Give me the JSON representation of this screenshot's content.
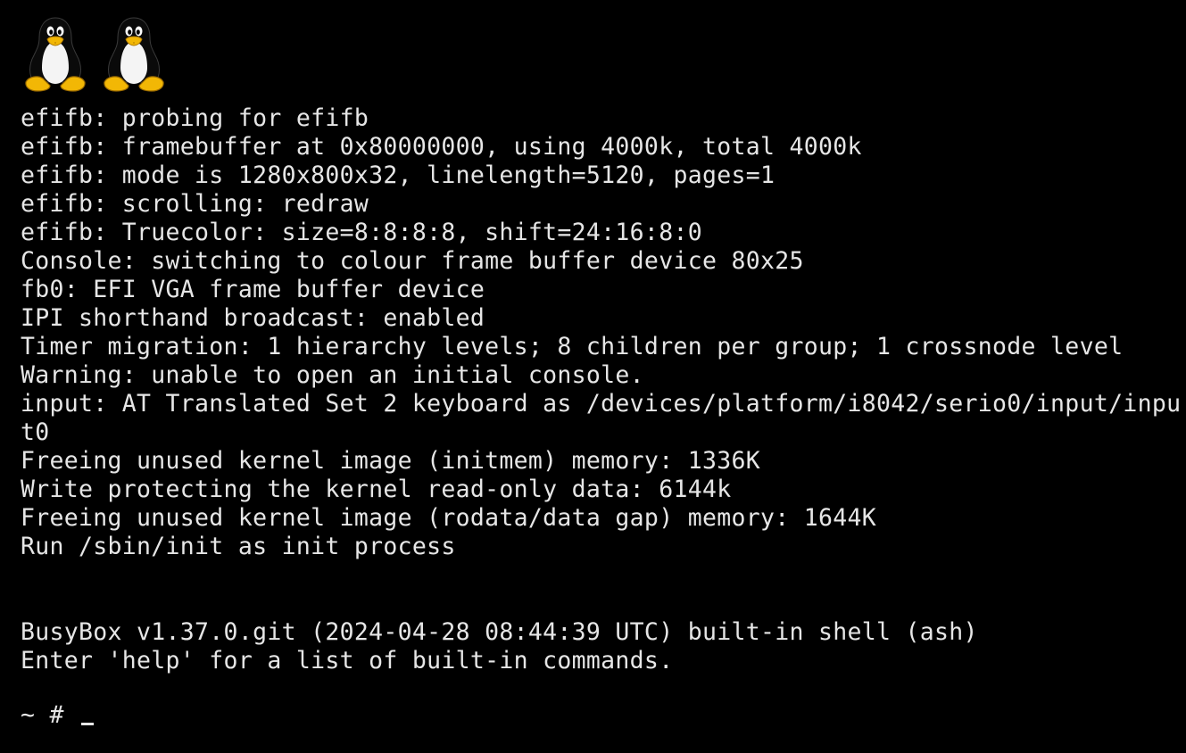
{
  "colors": {
    "background": "#000000",
    "text": "#e6e6e6",
    "tux_beak": "#f2b705"
  },
  "boot_logo": {
    "icons": [
      "tux-penguin-icon",
      "tux-penguin-icon"
    ]
  },
  "log_lines": [
    "efifb: probing for efifb",
    "efifb: framebuffer at 0x80000000, using 4000k, total 4000k",
    "efifb: mode is 1280x800x32, linelength=5120, pages=1",
    "efifb: scrolling: redraw",
    "efifb: Truecolor: size=8:8:8:8, shift=24:16:8:0",
    "Console: switching to colour frame buffer device 80x25",
    "fb0: EFI VGA frame buffer device",
    "IPI shorthand broadcast: enabled",
    "Timer migration: 1 hierarchy levels; 8 children per group; 1 crossnode level",
    "Warning: unable to open an initial console.",
    "input: AT Translated Set 2 keyboard as /devices/platform/i8042/serio0/input/inpu",
    "t0",
    "Freeing unused kernel image (initmem) memory: 1336K",
    "Write protecting the kernel read-only data: 6144k",
    "Freeing unused kernel image (rodata/data gap) memory: 1644K",
    "Run /sbin/init as init process",
    "",
    "",
    "BusyBox v1.37.0.git (2024-04-28 08:44:39 UTC) built-in shell (ash)",
    "Enter 'help' for a list of built-in commands.",
    ""
  ],
  "shell": {
    "prompt": "~ #",
    "input_value": ""
  }
}
